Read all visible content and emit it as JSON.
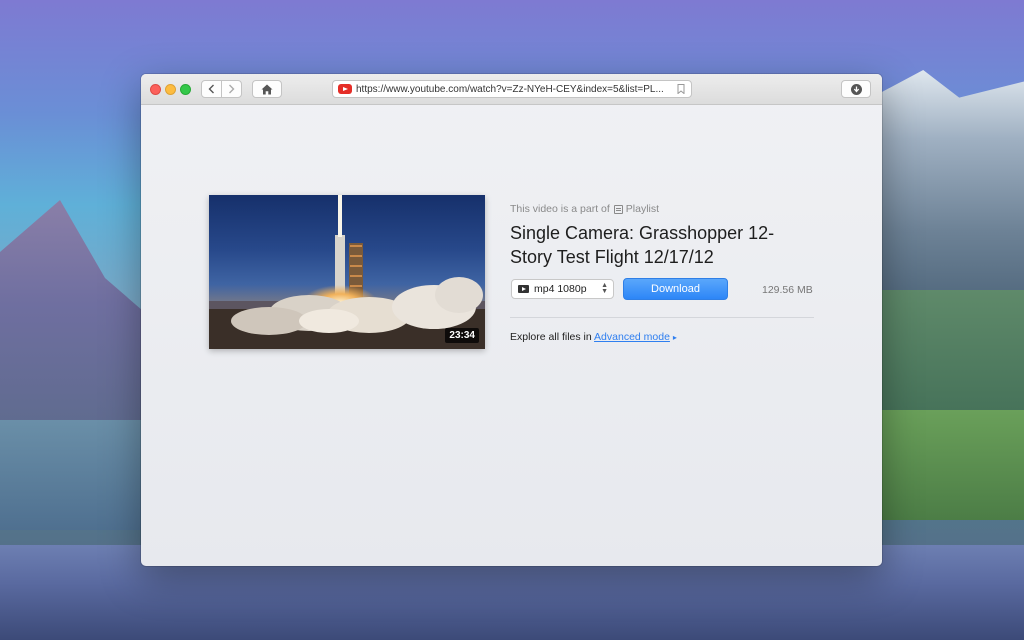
{
  "toolbar": {
    "url": "https://www.youtube.com/watch?v=Zz-NYeH-CEY&index=5&list=PL..."
  },
  "video": {
    "duration": "23:34",
    "part_of_prefix": "This video is a part of",
    "playlist_label": "Playlist",
    "title": "Single Camera: Grasshopper 12-Story Test Flight 12/17/12"
  },
  "download": {
    "format": "mp4 1080p",
    "button_label": "Download",
    "file_size": "129.56 MB"
  },
  "explore": {
    "prefix": "Explore all files in",
    "link_label": "Advanced mode",
    "link_arrow": "▸"
  },
  "colors": {
    "accent": "#2f86f7",
    "link": "#2f7ff0"
  }
}
